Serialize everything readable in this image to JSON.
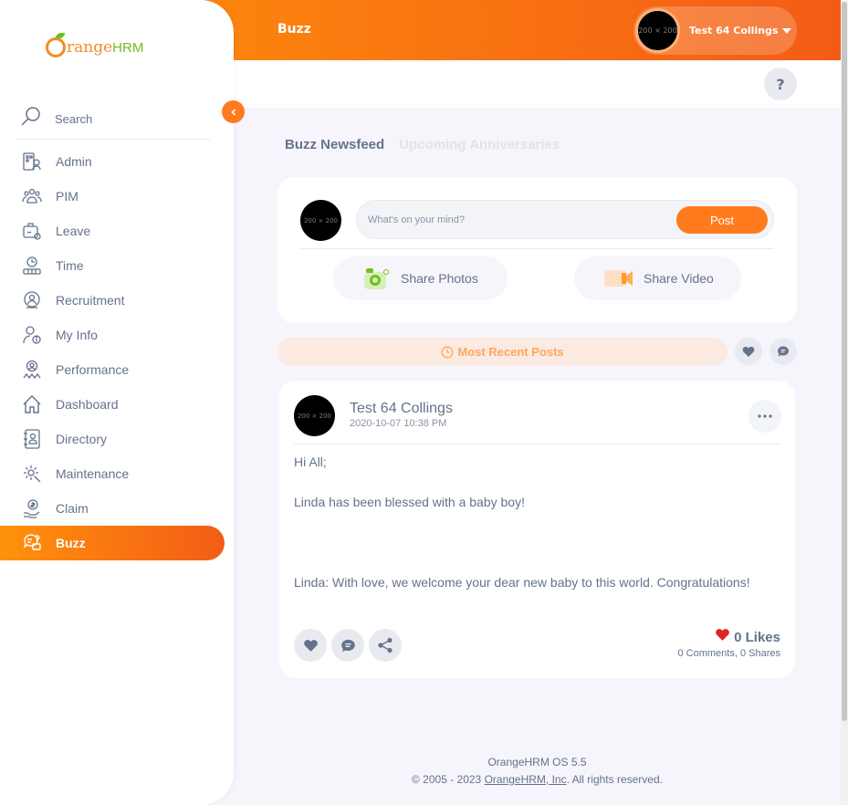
{
  "topbar": {
    "title": "Buzz",
    "avatar_placeholder": "200 × 200",
    "user_name": "Test 64 Collings"
  },
  "help": {
    "label": "?"
  },
  "sidebar": {
    "logo_orange": "range",
    "logo_hrm": "HRM",
    "search_label": "Search",
    "items": [
      {
        "label": "Admin",
        "icon": "admin-icon"
      },
      {
        "label": "PIM",
        "icon": "pim-icon"
      },
      {
        "label": "Leave",
        "icon": "leave-icon"
      },
      {
        "label": "Time",
        "icon": "time-icon"
      },
      {
        "label": "Recruitment",
        "icon": "recruitment-icon"
      },
      {
        "label": "My Info",
        "icon": "my-info-icon"
      },
      {
        "label": "Performance",
        "icon": "performance-icon"
      },
      {
        "label": "Dashboard",
        "icon": "dashboard-icon"
      },
      {
        "label": "Directory",
        "icon": "directory-icon"
      },
      {
        "label": "Maintenance",
        "icon": "maintenance-icon"
      },
      {
        "label": "Claim",
        "icon": "claim-icon"
      },
      {
        "label": "Buzz",
        "icon": "buzz-icon",
        "active": true
      }
    ]
  },
  "tabs": {
    "newsfeed": "Buzz Newsfeed",
    "anniversaries": "Upcoming Anniversaries"
  },
  "composer": {
    "avatar_placeholder": "200 × 200",
    "placeholder": "What's on your mind?",
    "post_label": "Post",
    "share_photos": "Share Photos",
    "share_video": "Share Video"
  },
  "filter": {
    "most_recent": "Most Recent Posts"
  },
  "post": {
    "avatar_placeholder": "200 × 200",
    "author": "Test 64 Collings",
    "time": "2020-10-07 10:38 PM",
    "line1": "Hi All;",
    "line2": "Linda has been blessed with a baby boy!",
    "line3": "Linda: With love, we welcome your dear new baby to this world. Congratulations!",
    "likes": "0 Likes",
    "comments": "0 Comments",
    "shares": "0 Shares"
  },
  "footer": {
    "version": "OrangeHRM OS 5.5",
    "copyright_prefix": "© 2005 - 2023 ",
    "company": "OrangeHRM, Inc",
    "copyright_suffix": ". All rights reserved."
  },
  "colors": {
    "accent": "#ff7b1d",
    "gradient_start": "#ff920b",
    "gradient_end": "#f35c17",
    "text": "#64728c",
    "like_heart": "#e02424"
  }
}
